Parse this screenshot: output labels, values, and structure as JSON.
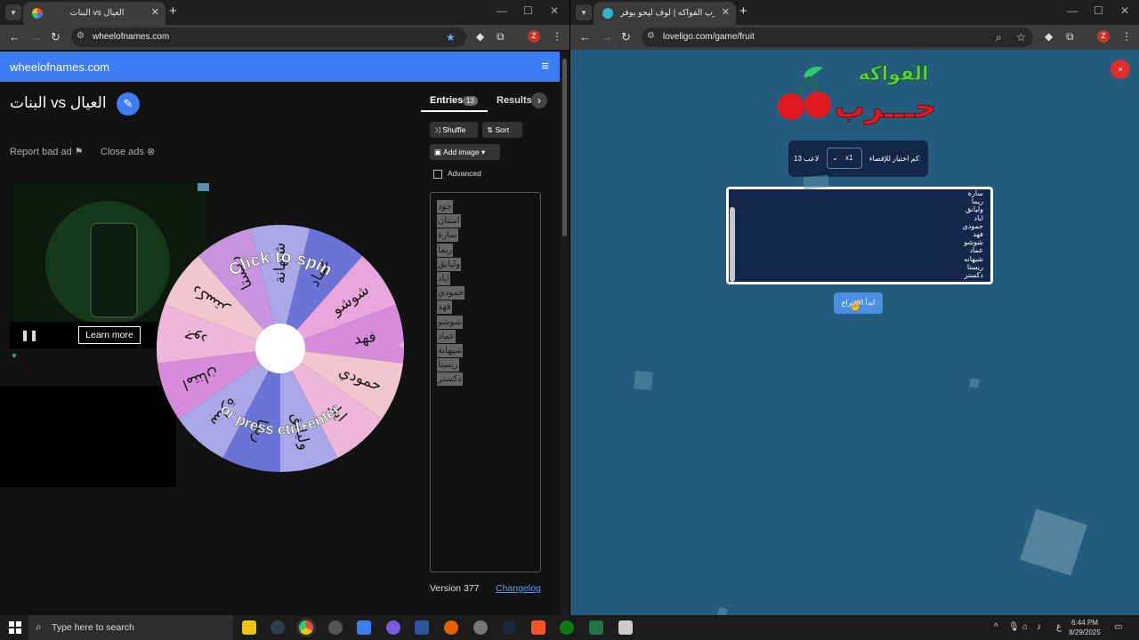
{
  "left_browser": {
    "tab_title": "البنات vs العيال",
    "url": "wheelofnames.com",
    "profile_letter": "Z"
  },
  "wheel_app": {
    "brand": "wheelofnames.com",
    "title": "البنات vs العيال",
    "report_ad": "Report bad ad",
    "close_ads": "Close ads",
    "learn_more": "Learn more",
    "wheel_top_text": "Click to spin",
    "wheel_bottom_text": "or press ctrl+enter",
    "wheel_labels": [
      "عماد",
      "شوشو",
      "فهد",
      "حمودي",
      "اياد",
      "وليانق",
      "ريما",
      "سارة",
      "امتنان",
      "جود",
      "دكستر",
      "ريستا",
      "شيهانة"
    ],
    "wheel_colors": [
      "#6b74d6",
      "#e9a6dd",
      "#d78bdb",
      "#f1c6cf",
      "#eeb6d8",
      "#a9a7e8",
      "#6b74d6",
      "#a9a7e8",
      "#d78bdb",
      "#eeb6d8",
      "#f1c6cf",
      "#c894e0",
      "#a9a7e8"
    ],
    "tab_entries": "Entries",
    "entries_count": "13",
    "tab_results": "Results",
    "shuffle": "Shuffle",
    "sort": "Sort",
    "add_image": "Add image",
    "advanced": "Advanced",
    "entries": [
      "جود",
      "امتنان",
      "سارة",
      "ريما",
      "وليانق",
      "اياد",
      "حمودي",
      "فهد",
      "شوشو",
      "عماد",
      "شيهانة",
      "ريستا",
      "دكستر"
    ],
    "version": "Version 377",
    "changelog": "Changelog"
  },
  "right_browser": {
    "tab_title": "لعبة حرب الفواكه | لوف ليجو يوفر",
    "url": "loveligo.com/game/fruit",
    "profile_letter": "Z"
  },
  "fruit_game": {
    "logo_top": "الفواكه",
    "logo_bottom": "حـــرب",
    "close": "×",
    "elimination_label": "كم اختيار للإقصاء:",
    "elimination_value": "x1",
    "players_label": "13 لاعب",
    "names": [
      "سارة",
      "ريما",
      "وليانق",
      "اياد",
      "حمودي",
      "فهد",
      "شوشو",
      "عماد",
      "شيهانه",
      "ريستا",
      "دكستر"
    ],
    "start_button": "ابدأ الاقتراع"
  },
  "taskbar": {
    "search_placeholder": "Type here to search",
    "lang": "ع",
    "time": "6:44 PM",
    "date": "8/29/2025"
  }
}
